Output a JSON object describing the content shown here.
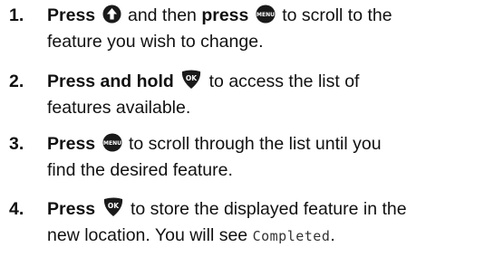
{
  "steps": [
    {
      "number": "1.",
      "press1": "Press",
      "t1": " and then ",
      "press2": "press",
      "t2": " to scroll to the",
      "line2": "feature you wish to change."
    },
    {
      "number": "2.",
      "press": "Press and hold",
      "t1": " to access the list of",
      "line2": "features available."
    },
    {
      "number": "3.",
      "press": "Press",
      "t1": " to scroll through the list until you",
      "line2": "find the desired feature."
    },
    {
      "number": "4.",
      "press": "Press",
      "t1": " to store the displayed feature in the",
      "line2a": "new location. You will see ",
      "display_text": "Completed",
      "line2b": "."
    }
  ],
  "icons": {
    "up_arrow": "up-arrow-key-icon",
    "menu": "menu-key-icon",
    "ok": "ok-key-icon",
    "menu_key_label": "MENU",
    "ok_key_label": "OK"
  },
  "colors": {
    "text": "#111111",
    "key_fill": "#1a1a1a",
    "key_glyph": "#ffffff"
  }
}
